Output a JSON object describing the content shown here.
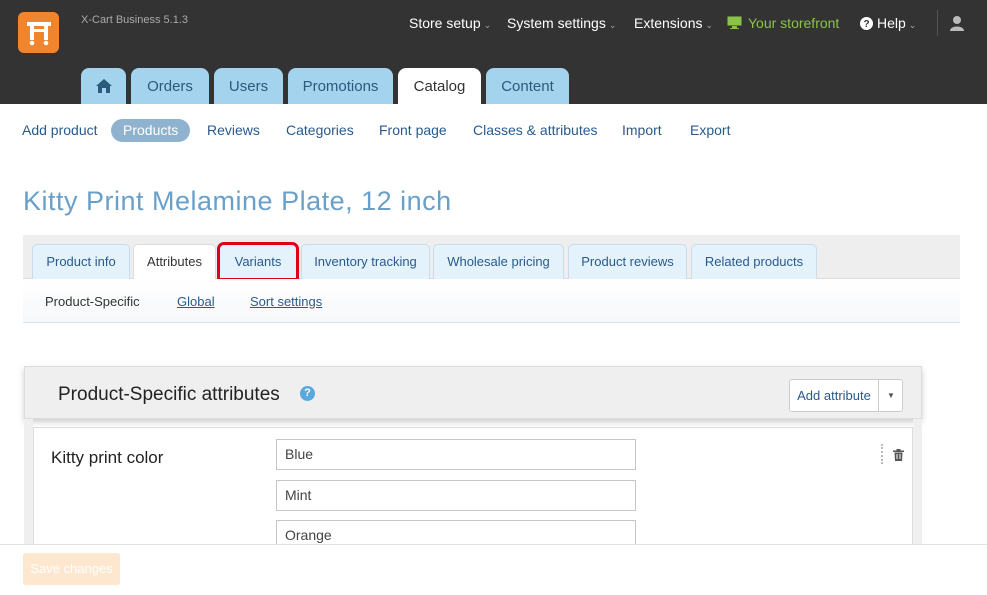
{
  "header": {
    "version": "X-Cart Business 5.1.3",
    "nav": [
      {
        "label": "Store setup"
      },
      {
        "label": "System settings"
      },
      {
        "label": "Extensions"
      },
      {
        "label": "Your storefront"
      },
      {
        "label": "Help"
      }
    ],
    "tabs": [
      "Orders",
      "Users",
      "Promotions",
      "Catalog",
      "Content"
    ],
    "active_tab": "Catalog",
    "brand_color": "#f0852f"
  },
  "subnav": {
    "items": [
      "Add product",
      "Products",
      "Reviews",
      "Categories",
      "Front page",
      "Classes & attributes",
      "Import",
      "Export"
    ],
    "active": "Products"
  },
  "page": {
    "title": "Kitty Print Melamine Plate, 12 inch"
  },
  "product_tabs": {
    "items": [
      "Product info",
      "Attributes",
      "Variants",
      "Inventory tracking",
      "Wholesale pricing",
      "Product reviews",
      "Related products"
    ],
    "active": "Attributes",
    "highlighted": "Variants"
  },
  "attribute_tabs": {
    "items": [
      "Product-Specific",
      "Global",
      "Sort settings"
    ],
    "active": "Product-Specific"
  },
  "attributes_panel": {
    "title": "Product-Specific attributes",
    "help_glyph": "?",
    "add_button": "Add attribute",
    "attribute": {
      "name": "Kitty print color",
      "values": [
        "Blue",
        "Mint",
        "Orange"
      ]
    }
  },
  "footer": {
    "save_button": "Save changes"
  }
}
